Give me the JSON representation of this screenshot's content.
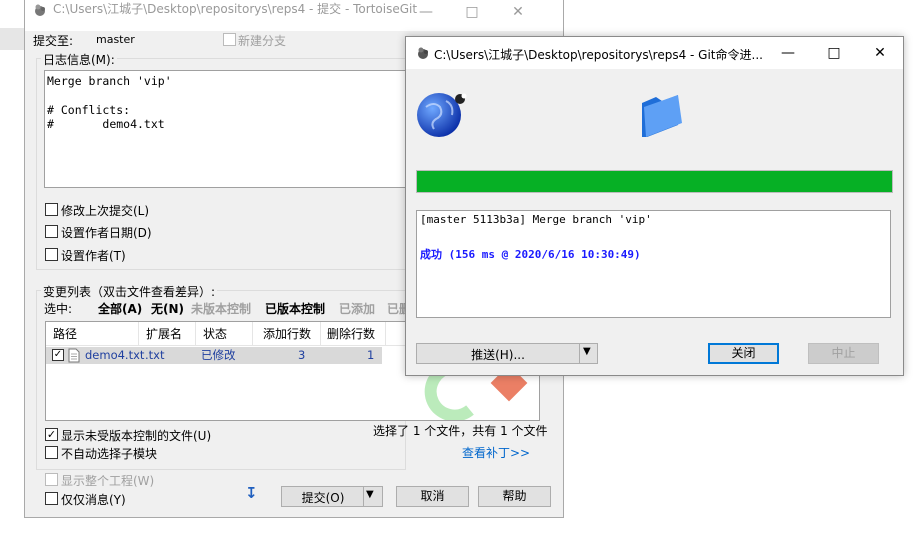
{
  "commit_dialog": {
    "title": "C:\\Users\\江城子\\Desktop\\repositorys\\reps4 - 提交 - TortoiseGit",
    "commit_to_label": "提交至:",
    "branch": "master",
    "new_branch_label": "新建分支",
    "log_message_label": "日志信息(M):",
    "log_message": "Merge branch 'vip'\n\n# Conflicts:\n#\tdemo4.txt",
    "amend_label": "修改上次提交(L)",
    "set_author_date_label": "设置作者日期(D)",
    "set_author_label": "设置作者(T)",
    "changes_label": "变更列表（双击文件查看差异）:",
    "select_label": "选中:",
    "filters": [
      {
        "label": "全部(A)",
        "style": "bold"
      },
      {
        "label": "无(N)",
        "style": "bold"
      },
      {
        "label": "未版本控制",
        "style": "gray"
      },
      {
        "label": "已版本控制",
        "style": "bold"
      },
      {
        "label": "已添加",
        "style": "gray"
      },
      {
        "label": "已删",
        "style": "gray"
      }
    ],
    "table": {
      "columns": [
        "路径",
        "扩展名",
        "状态",
        "添加行数",
        "删除行数"
      ],
      "rows": [
        {
          "checked": true,
          "path": "demo4.txt",
          "ext": ".txt",
          "status": "已修改",
          "added": "3",
          "deleted": "1"
        }
      ]
    },
    "show_unversioned_label": "显示未受版本控制的文件(U)",
    "no_autoselect_label": "不自动选择子模块",
    "selection_status": "选择了 1 个文件，共有 1 个文件",
    "view_patch_label": "查看补丁>>",
    "show_whole_project_label": "显示整个工程(W)",
    "message_only_label": "仅仅消息(Y)",
    "commit_button": "提交(O)",
    "cancel_button": "取消",
    "help_button": "帮助"
  },
  "progress_dialog": {
    "title": "C:\\Users\\江城子\\Desktop\\repositorys\\reps4 - Git命令进...",
    "progress": 1.0,
    "progress_color": "#06b025",
    "output_line1": "[master 5113b3a] Merge branch 'vip'",
    "output_line2": "成功 (156 ms @ 2020/6/16 10:30:49)",
    "success_color": "#1a1aff",
    "push_button": "推送(H)...",
    "close_button": "关闭",
    "abort_button": "中止"
  }
}
